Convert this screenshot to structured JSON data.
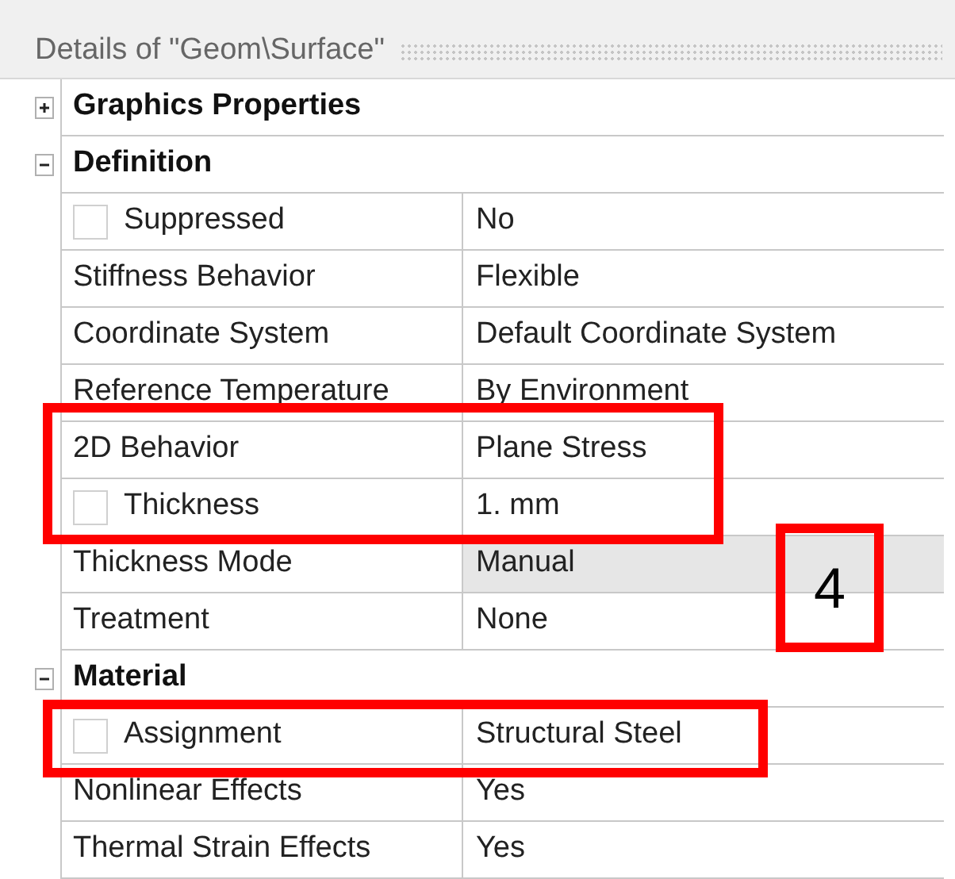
{
  "panel": {
    "title": "Details of \"Geom\\Surface\""
  },
  "rows": [
    {
      "kind": "group",
      "label": "Graphics Properties",
      "expanded": false
    },
    {
      "kind": "group",
      "label": "Definition",
      "expanded": true
    },
    {
      "kind": "check",
      "label": "Suppressed",
      "value": "No",
      "checked": false,
      "shaded": false
    },
    {
      "kind": "prop",
      "label": "Stiffness Behavior",
      "value": "Flexible",
      "shaded": false
    },
    {
      "kind": "prop",
      "label": "Coordinate System",
      "value": "Default Coordinate System",
      "shaded": false
    },
    {
      "kind": "prop",
      "label": "Reference Temperature",
      "value": "By Environment",
      "shaded": false
    },
    {
      "kind": "prop",
      "label": "2D Behavior",
      "value": "Plane Stress",
      "shaded": false
    },
    {
      "kind": "check",
      "label": "Thickness",
      "value": "1. mm",
      "checked": false,
      "shaded": false
    },
    {
      "kind": "prop",
      "label": "Thickness Mode",
      "value": "Manual",
      "shaded": true
    },
    {
      "kind": "prop",
      "label": "Treatment",
      "value": "None",
      "shaded": false
    },
    {
      "kind": "group",
      "label": "Material",
      "expanded": true
    },
    {
      "kind": "check",
      "label": "Assignment",
      "value": "Structural Steel",
      "checked": false,
      "shaded": false
    },
    {
      "kind": "prop",
      "label": "Nonlinear Effects",
      "value": "Yes",
      "shaded": false
    },
    {
      "kind": "prop",
      "label": "Thermal Strain Effects",
      "value": "Yes",
      "shaded": false
    }
  ],
  "annotations": [
    {
      "kind": "frame"
    },
    {
      "kind": "frame",
      "label": "4"
    },
    {
      "kind": "frame"
    }
  ]
}
